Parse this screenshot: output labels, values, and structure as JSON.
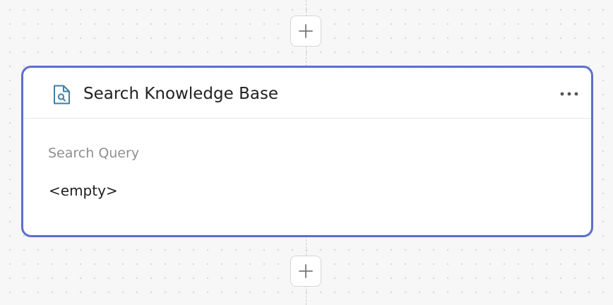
{
  "canvas": {
    "add_step_top_icon": "plus-icon",
    "add_step_bottom_icon": "plus-icon"
  },
  "node": {
    "icon": "document-search-icon",
    "title": "Search Knowledge Base",
    "menu_icon": "more-horizontal-icon",
    "accent_color": "#5b6fcd",
    "icon_color": "#3f7fa0",
    "fields": [
      {
        "label": "Search Query",
        "value": "<empty>"
      }
    ]
  }
}
